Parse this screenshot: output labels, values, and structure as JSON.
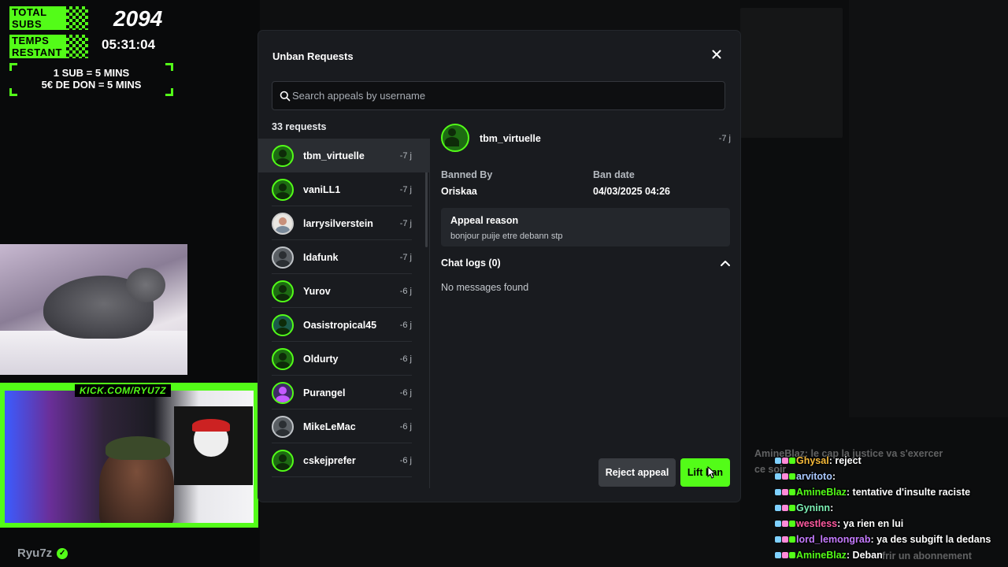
{
  "overlay": {
    "total_subs_label_1": "TOTAL",
    "total_subs_label_2": "SUBS",
    "temps_label_1": "TEMPS",
    "temps_label_2": "RESTANT",
    "subs_count": "2094",
    "timer": "05:31:04",
    "rule_1": "1 SUB = 5 MINS",
    "rule_2": "5€ DE DON = 5 MINS",
    "kick_url": "KICK.COM/RYU7Z",
    "channel_name": "Ryu7z",
    "accent": "#53fc18"
  },
  "modal": {
    "title": "Unban Requests",
    "search_placeholder": "Search appeals by username",
    "request_count": "33 requests",
    "requests": [
      {
        "username": "tbm_virtuelle",
        "time": "-7 j"
      },
      {
        "username": "vaniLL1",
        "time": "-7 j"
      },
      {
        "username": "larrysilverstein",
        "time": "-7 j"
      },
      {
        "username": "Idafunk",
        "time": "-7 j"
      },
      {
        "username": "Yurov",
        "time": "-6 j"
      },
      {
        "username": "Oasistropical45",
        "time": "-6 j"
      },
      {
        "username": "Oldurty",
        "time": "-6 j"
      },
      {
        "username": "Purangel",
        "time": "-6 j"
      },
      {
        "username": "MikeLeMac",
        "time": "-6 j"
      },
      {
        "username": "cskejprefer",
        "time": "-6 j"
      }
    ],
    "detail": {
      "username": "tbm_virtuelle",
      "time": "-7 j",
      "banned_by_label": "Banned By",
      "banned_by": "Oriskaa",
      "ban_date_label": "Ban date",
      "ban_date": "04/03/2025 04:26",
      "appeal_reason_label": "Appeal reason",
      "appeal_reason": "bonjour puije etre debann stp",
      "chat_logs_label": "Chat logs (0)",
      "no_messages": "No messages found"
    },
    "reject_label": "Reject appeal",
    "lift_label": "Lift ban"
  },
  "chat": [
    {
      "user": "Ghysal",
      "color": "#f5b93a",
      "message": "reject"
    },
    {
      "user": "arvitoto",
      "color": "#a9c8ff",
      "message": ""
    },
    {
      "user": "AmineBlaz",
      "color": "#53fc18",
      "message": "tentative d'insulte raciste"
    },
    {
      "user": "Gyninn",
      "color": "#7cf0b5",
      "message": ""
    },
    {
      "user": "westless",
      "color": "#ff5aa0",
      "message": "ya rien en lui"
    },
    {
      "user": "lord_lemongrab",
      "color": "#c57bff",
      "message": "ya des subgift la dedans"
    },
    {
      "user": "AmineBlaz",
      "color": "#53fc18",
      "message": "Deban"
    }
  ],
  "ghost": {
    "line_1": "AmineBlaz: le cap la justice va s'exercer",
    "line_2": "ce soir",
    "line_3": "frir un abonnement"
  }
}
